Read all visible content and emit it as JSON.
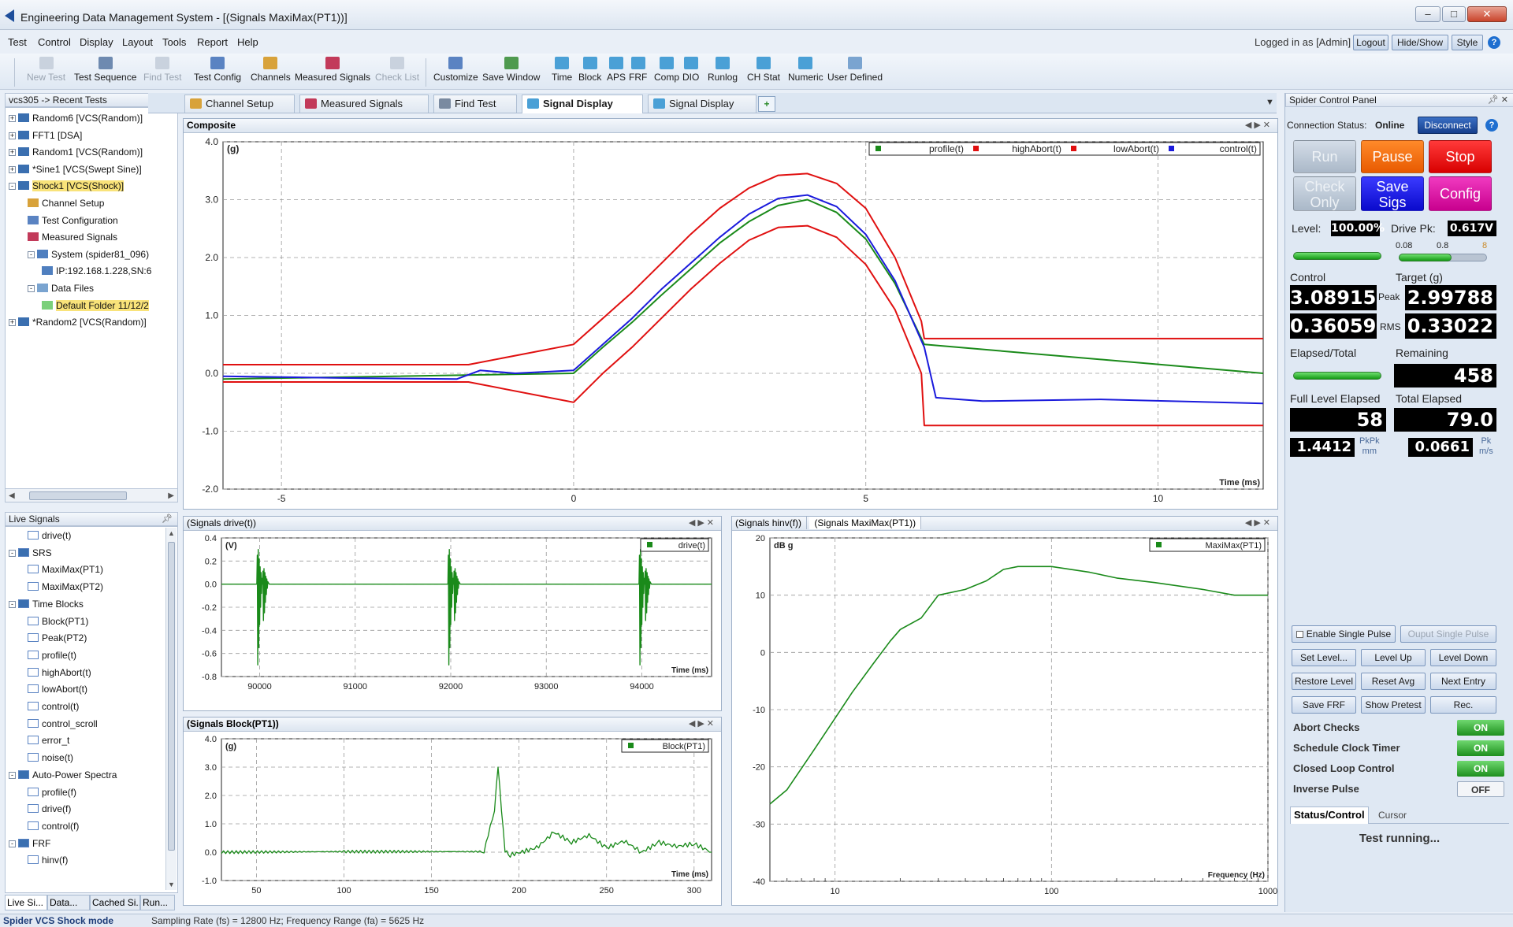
{
  "window": {
    "title": "Engineering Data Management System - [(Signals MaxiMax(PT1))]"
  },
  "menu": [
    "Test",
    "Control",
    "Display",
    "Layout",
    "Tools",
    "Report",
    "Help"
  ],
  "login": {
    "text": "Logged in as [Admin]",
    "logout": "Logout",
    "hideshow": "Hide/Show",
    "style": "Style",
    "help": "?"
  },
  "toolbar": [
    {
      "label": "New Test",
      "enabled": false,
      "icon": "new-test-icon"
    },
    {
      "label": "Test Sequence",
      "enabled": true,
      "icon": "test-sequence-icon"
    },
    {
      "label": "Find Test",
      "enabled": false,
      "icon": "find-test-icon"
    },
    {
      "label": "Test Config",
      "enabled": true,
      "icon": "test-config-icon"
    },
    {
      "label": "Channels",
      "enabled": true,
      "icon": "channels-icon"
    },
    {
      "label": "Measured Signals",
      "enabled": true,
      "icon": "measured-signals-icon"
    },
    {
      "label": "Check List",
      "enabled": false,
      "icon": "check-list-icon"
    },
    {
      "label": "Customize",
      "enabled": true,
      "icon": "customize-icon"
    },
    {
      "label": "Save Window",
      "enabled": true,
      "icon": "save-window-icon"
    },
    {
      "label": "Time",
      "enabled": true,
      "icon": "time-icon"
    },
    {
      "label": "Block",
      "enabled": true,
      "icon": "block-icon"
    },
    {
      "label": "APS",
      "enabled": true,
      "icon": "aps-icon"
    },
    {
      "label": "FRF",
      "enabled": true,
      "icon": "frf-icon"
    },
    {
      "label": "Comp",
      "enabled": true,
      "icon": "comp-icon"
    },
    {
      "label": "DIO",
      "enabled": true,
      "icon": "dio-icon"
    },
    {
      "label": "Runlog",
      "enabled": true,
      "icon": "runlog-icon"
    },
    {
      "label": "CH Stat",
      "enabled": true,
      "icon": "ch-stat-icon"
    },
    {
      "label": "Numeric",
      "enabled": true,
      "icon": "numeric-icon"
    },
    {
      "label": "User Defined",
      "enabled": true,
      "icon": "user-defined-icon"
    }
  ],
  "recent": {
    "header": "vcs305 -> Recent Tests",
    "items": [
      {
        "label": "Random6 [VCS(Random)]",
        "exp": "+"
      },
      {
        "label": "FFT1 [DSA]",
        "exp": "+"
      },
      {
        "label": "Random1 [VCS(Random)]",
        "exp": "+"
      },
      {
        "label": "*Sine1 [VCS(Swept Sine)]",
        "exp": "+"
      },
      {
        "label": "Shock1 [VCS(Shock)]",
        "exp": "-"
      },
      {
        "label": "Channel Setup"
      },
      {
        "label": "Test Configuration"
      },
      {
        "label": "Measured Signals"
      },
      {
        "label": "System (spider81_096)",
        "exp": "-"
      },
      {
        "label": "IP:192.168.1.228,SN:6"
      },
      {
        "label": "Data Files",
        "exp": "-"
      },
      {
        "label": "Default Folder  11/12/2"
      },
      {
        "label": "*Random2 [VCS(Random)]",
        "exp": "+"
      }
    ]
  },
  "live": {
    "header": "Live Signals",
    "items": [
      {
        "label": "drive(t)"
      },
      {
        "label": "SRS",
        "exp": "-"
      },
      {
        "label": "MaxiMax(PT1)"
      },
      {
        "label": "MaxiMax(PT2)"
      },
      {
        "label": "Time Blocks",
        "exp": "-"
      },
      {
        "label": "Block(PT1)"
      },
      {
        "label": "Peak(PT2)"
      },
      {
        "label": "profile(t)"
      },
      {
        "label": "highAbort(t)"
      },
      {
        "label": "lowAbort(t)"
      },
      {
        "label": "control(t)"
      },
      {
        "label": "control_scroll"
      },
      {
        "label": "error_t"
      },
      {
        "label": "noise(t)"
      },
      {
        "label": "Auto-Power Spectra",
        "exp": "-"
      },
      {
        "label": "profile(f)"
      },
      {
        "label": "drive(f)"
      },
      {
        "label": "control(f)"
      },
      {
        "label": "FRF",
        "exp": "-"
      },
      {
        "label": "hinv(f)"
      }
    ],
    "bottom_tabs": [
      "Live Si...",
      "Data...",
      "Cached Si...",
      "Run..."
    ]
  },
  "tabs": [
    {
      "label": "Channel Setup",
      "active": false
    },
    {
      "label": "Measured Signals",
      "active": false
    },
    {
      "label": "Find Test",
      "active": false
    },
    {
      "label": "Signal Display",
      "active": true
    },
    {
      "label": "Signal Display",
      "active": false
    }
  ],
  "composite": {
    "header": "Composite",
    "ylabel": "(g)",
    "xlabel": "Time (ms)",
    "legend": [
      "profile(t)",
      "highAbort(t)",
      "lowAbort(t)",
      "control(t)"
    ],
    "yticks": [
      "4.0",
      "3.0",
      "2.0",
      "1.0",
      "0.0",
      "-1.0",
      "-2.0"
    ],
    "xticks": [
      "-5",
      "0",
      "5",
      "10"
    ]
  },
  "drive_chart": {
    "header": "(Signals drive(t))",
    "ylabel": "(V)",
    "xlabel": "Time (ms)",
    "legend": "drive(t)",
    "yticks": [
      "0.4",
      "0.2",
      "0.0",
      "-0.2",
      "-0.4",
      "-0.6",
      "-0.8"
    ],
    "xticks": [
      "90000",
      "91000",
      "92000",
      "93000",
      "94000"
    ]
  },
  "block_chart": {
    "header": "(Signals Block(PT1))",
    "ylabel": "(g)",
    "xlabel": "Time (ms)",
    "legend": "Block(PT1)",
    "yticks": [
      "4.0",
      "3.0",
      "2.0",
      "1.0",
      "0.0",
      "-1.0"
    ],
    "xticks": [
      "50",
      "100",
      "150",
      "200",
      "250",
      "300"
    ]
  },
  "srs_chart": {
    "header_tabs": [
      "(Signals hinv(f))",
      "(Signals MaxiMax(PT1))"
    ],
    "ylabel": "dB g",
    "xlabel": "Frequency (Hz)",
    "legend": "MaxiMax(PT1)",
    "yticks": [
      "20",
      "10",
      "0",
      "-10",
      "-20",
      "-30",
      "-40"
    ],
    "xticks": [
      "10",
      "100",
      "1000"
    ]
  },
  "chart_data": [
    {
      "type": "line",
      "title": "Composite",
      "xlabel": "Time (ms)",
      "ylabel": "(g)",
      "xlim": [
        -6.0,
        11.8
      ],
      "ylim": [
        -2.0,
        4.0
      ],
      "grid": true,
      "legend_position": "top-right",
      "series": [
        {
          "name": "profile(t)",
          "color": "#1a8a1a",
          "x": [
            -6,
            0,
            0.5,
            1,
            1.5,
            2,
            2.5,
            3,
            3.5,
            4,
            4.5,
            5,
            5.5,
            6,
            11.8
          ],
          "y": [
            -0.1,
            0.0,
            0.45,
            0.88,
            1.35,
            1.8,
            2.25,
            2.62,
            2.9,
            3.0,
            2.78,
            2.32,
            1.55,
            0.5,
            0.0
          ]
        },
        {
          "name": "highAbort(t)",
          "color": "#e01010",
          "x": [
            -6,
            -1.8,
            0,
            0.5,
            1,
            1.5,
            2,
            2.5,
            3,
            3.5,
            4,
            4.5,
            5,
            5.5,
            5.95,
            6,
            11.8
          ],
          "y": [
            0.15,
            0.15,
            0.5,
            0.95,
            1.4,
            1.9,
            2.4,
            2.85,
            3.2,
            3.42,
            3.45,
            3.28,
            2.85,
            2.0,
            0.9,
            0.6,
            0.6
          ]
        },
        {
          "name": "lowAbort(t)",
          "color": "#e01010",
          "x": [
            -6,
            -1.8,
            0,
            0.5,
            1,
            1.5,
            2,
            2.5,
            3,
            3.5,
            4,
            4.5,
            5,
            5.5,
            5.95,
            6,
            11.8
          ],
          "y": [
            -0.15,
            -0.15,
            -0.5,
            0.0,
            0.45,
            0.95,
            1.45,
            1.9,
            2.3,
            2.52,
            2.55,
            2.35,
            1.88,
            1.1,
            0.0,
            -0.9,
            -0.9
          ]
        },
        {
          "name": "control(t)",
          "color": "#1a1adc",
          "x": [
            -6,
            -4,
            -2,
            -1.6,
            -1,
            0,
            0.5,
            1,
            1.5,
            2,
            2.5,
            3,
            3.5,
            4,
            4.5,
            5,
            5.5,
            6,
            6.2,
            7,
            9,
            11.8
          ],
          "y": [
            -0.05,
            -0.08,
            -0.1,
            0.05,
            0.0,
            0.05,
            0.5,
            0.95,
            1.45,
            1.9,
            2.35,
            2.75,
            3.02,
            3.08,
            2.88,
            2.4,
            1.6,
            0.45,
            -0.42,
            -0.48,
            -0.45,
            -0.52
          ]
        }
      ]
    },
    {
      "type": "line",
      "title": "(Signals drive(t))",
      "xlabel": "Time (ms)",
      "ylabel": "(V)",
      "xlim": [
        89600,
        94730
      ],
      "ylim": [
        -0.8,
        0.4
      ],
      "grid": true,
      "legend_position": "top-right",
      "series": [
        {
          "name": "drive(t)",
          "color": "#1a8a1a",
          "bursts_at": [
            90000,
            92000,
            94000
          ],
          "baseline": 0.0
        }
      ]
    },
    {
      "type": "line",
      "title": "(Signals Block(PT1))",
      "xlabel": "Time (ms)",
      "ylabel": "(g)",
      "xlim": [
        30,
        310
      ],
      "ylim": [
        -1.0,
        4.0
      ],
      "grid": true,
      "legend_position": "top-right",
      "series": [
        {
          "name": "Block(PT1)",
          "color": "#1a8a1a",
          "x": [
            30,
            100,
            180,
            186,
            188,
            190,
            192,
            195,
            210,
            220,
            230,
            240,
            250,
            260,
            270,
            280,
            290,
            300,
            310
          ],
          "y": [
            0.0,
            0.02,
            0.02,
            1.5,
            3.05,
            1.5,
            0.05,
            -0.1,
            0.15,
            0.7,
            0.35,
            0.6,
            0.15,
            0.4,
            0.0,
            0.35,
            0.2,
            0.3,
            0.0
          ]
        }
      ]
    },
    {
      "type": "line",
      "title": "(Signals MaxiMax(PT1))",
      "xlabel": "Frequency (Hz)",
      "ylabel": "dB g",
      "xscale": "log",
      "xlim": [
        5,
        1000
      ],
      "ylim": [
        -40,
        20
      ],
      "grid": true,
      "legend_position": "top-right",
      "series": [
        {
          "name": "MaxiMax(PT1)",
          "color": "#1a8a1a",
          "x": [
            5,
            6,
            8,
            10,
            12,
            15,
            18,
            20,
            25,
            30,
            40,
            50,
            60,
            70,
            100,
            150,
            200,
            300,
            500,
            700,
            1000
          ],
          "y": [
            -26.5,
            -24,
            -17,
            -11.5,
            -7,
            -2,
            2,
            4,
            6,
            10,
            11,
            12.5,
            14.5,
            15,
            15,
            14,
            13,
            12.2,
            11,
            10,
            10
          ]
        }
      ]
    }
  ],
  "spider": {
    "header": "Spider Control Panel",
    "conn_label": "Connection Status:",
    "conn_value": "Online",
    "disconnect": "Disconnect",
    "buttons": {
      "run": "Run",
      "pause": "Pause",
      "stop": "Stop",
      "check_only": "Check\nOnly",
      "save_sigs": "Save\nSigs",
      "config": "Config"
    },
    "level_label": "Level:",
    "level_value": "100.00%",
    "drive_label": "Drive Pk:",
    "drive_value": "0.617V",
    "drive_scale": [
      "0.08",
      "0.8",
      "8"
    ],
    "drive_fraction": 0.6,
    "level_fraction": 1.0,
    "control_label": "Control",
    "target_label": "Target (g)",
    "control_peak": "3.08915",
    "target_peak": "2.99788",
    "peak_label": "Peak",
    "control_rms": "0.36059",
    "target_rms": "0.33022",
    "rms_label": "RMS",
    "elapsed_label": "Elapsed/Total",
    "remaining_label": "Remaining",
    "remaining_value": "458",
    "elapsed_fraction": 1.0,
    "full_level_label": "Full Level Elapsed",
    "full_level_value": "58",
    "total_elapsed_label": "Total Elapsed",
    "total_elapsed_value": "79.0",
    "pkpk_value": "1.4412",
    "pkpk_unit": "PkPk\nmm",
    "pk_value": "0.0661",
    "pk_unit": "Pk\nm/s",
    "enable_single_pulse": "Enable Single Pulse",
    "output_single_pulse": "Ouput Single Pulse",
    "row1": [
      "Set Level...",
      "Level  Up",
      "Level Down"
    ],
    "row2": [
      "Restore Level",
      "Reset Avg",
      "Next Entry"
    ],
    "row3": [
      "Save FRF",
      "Show Pretest",
      "Rec."
    ],
    "toggles": [
      {
        "label": "Abort Checks",
        "value": "ON"
      },
      {
        "label": "Schedule Clock Timer",
        "value": "ON"
      },
      {
        "label": "Closed Loop Control",
        "value": "ON"
      },
      {
        "label": "Inverse Pulse",
        "value": "OFF"
      }
    ],
    "bottom_tabs": [
      "Status/Control",
      "Cursor"
    ],
    "status": "Test running..."
  },
  "statusbar": {
    "mode": "Spider VCS Shock mode",
    "info": "Sampling Rate (fs) = 12800 Hz; Frequency Range (fa) = 5625 Hz"
  }
}
